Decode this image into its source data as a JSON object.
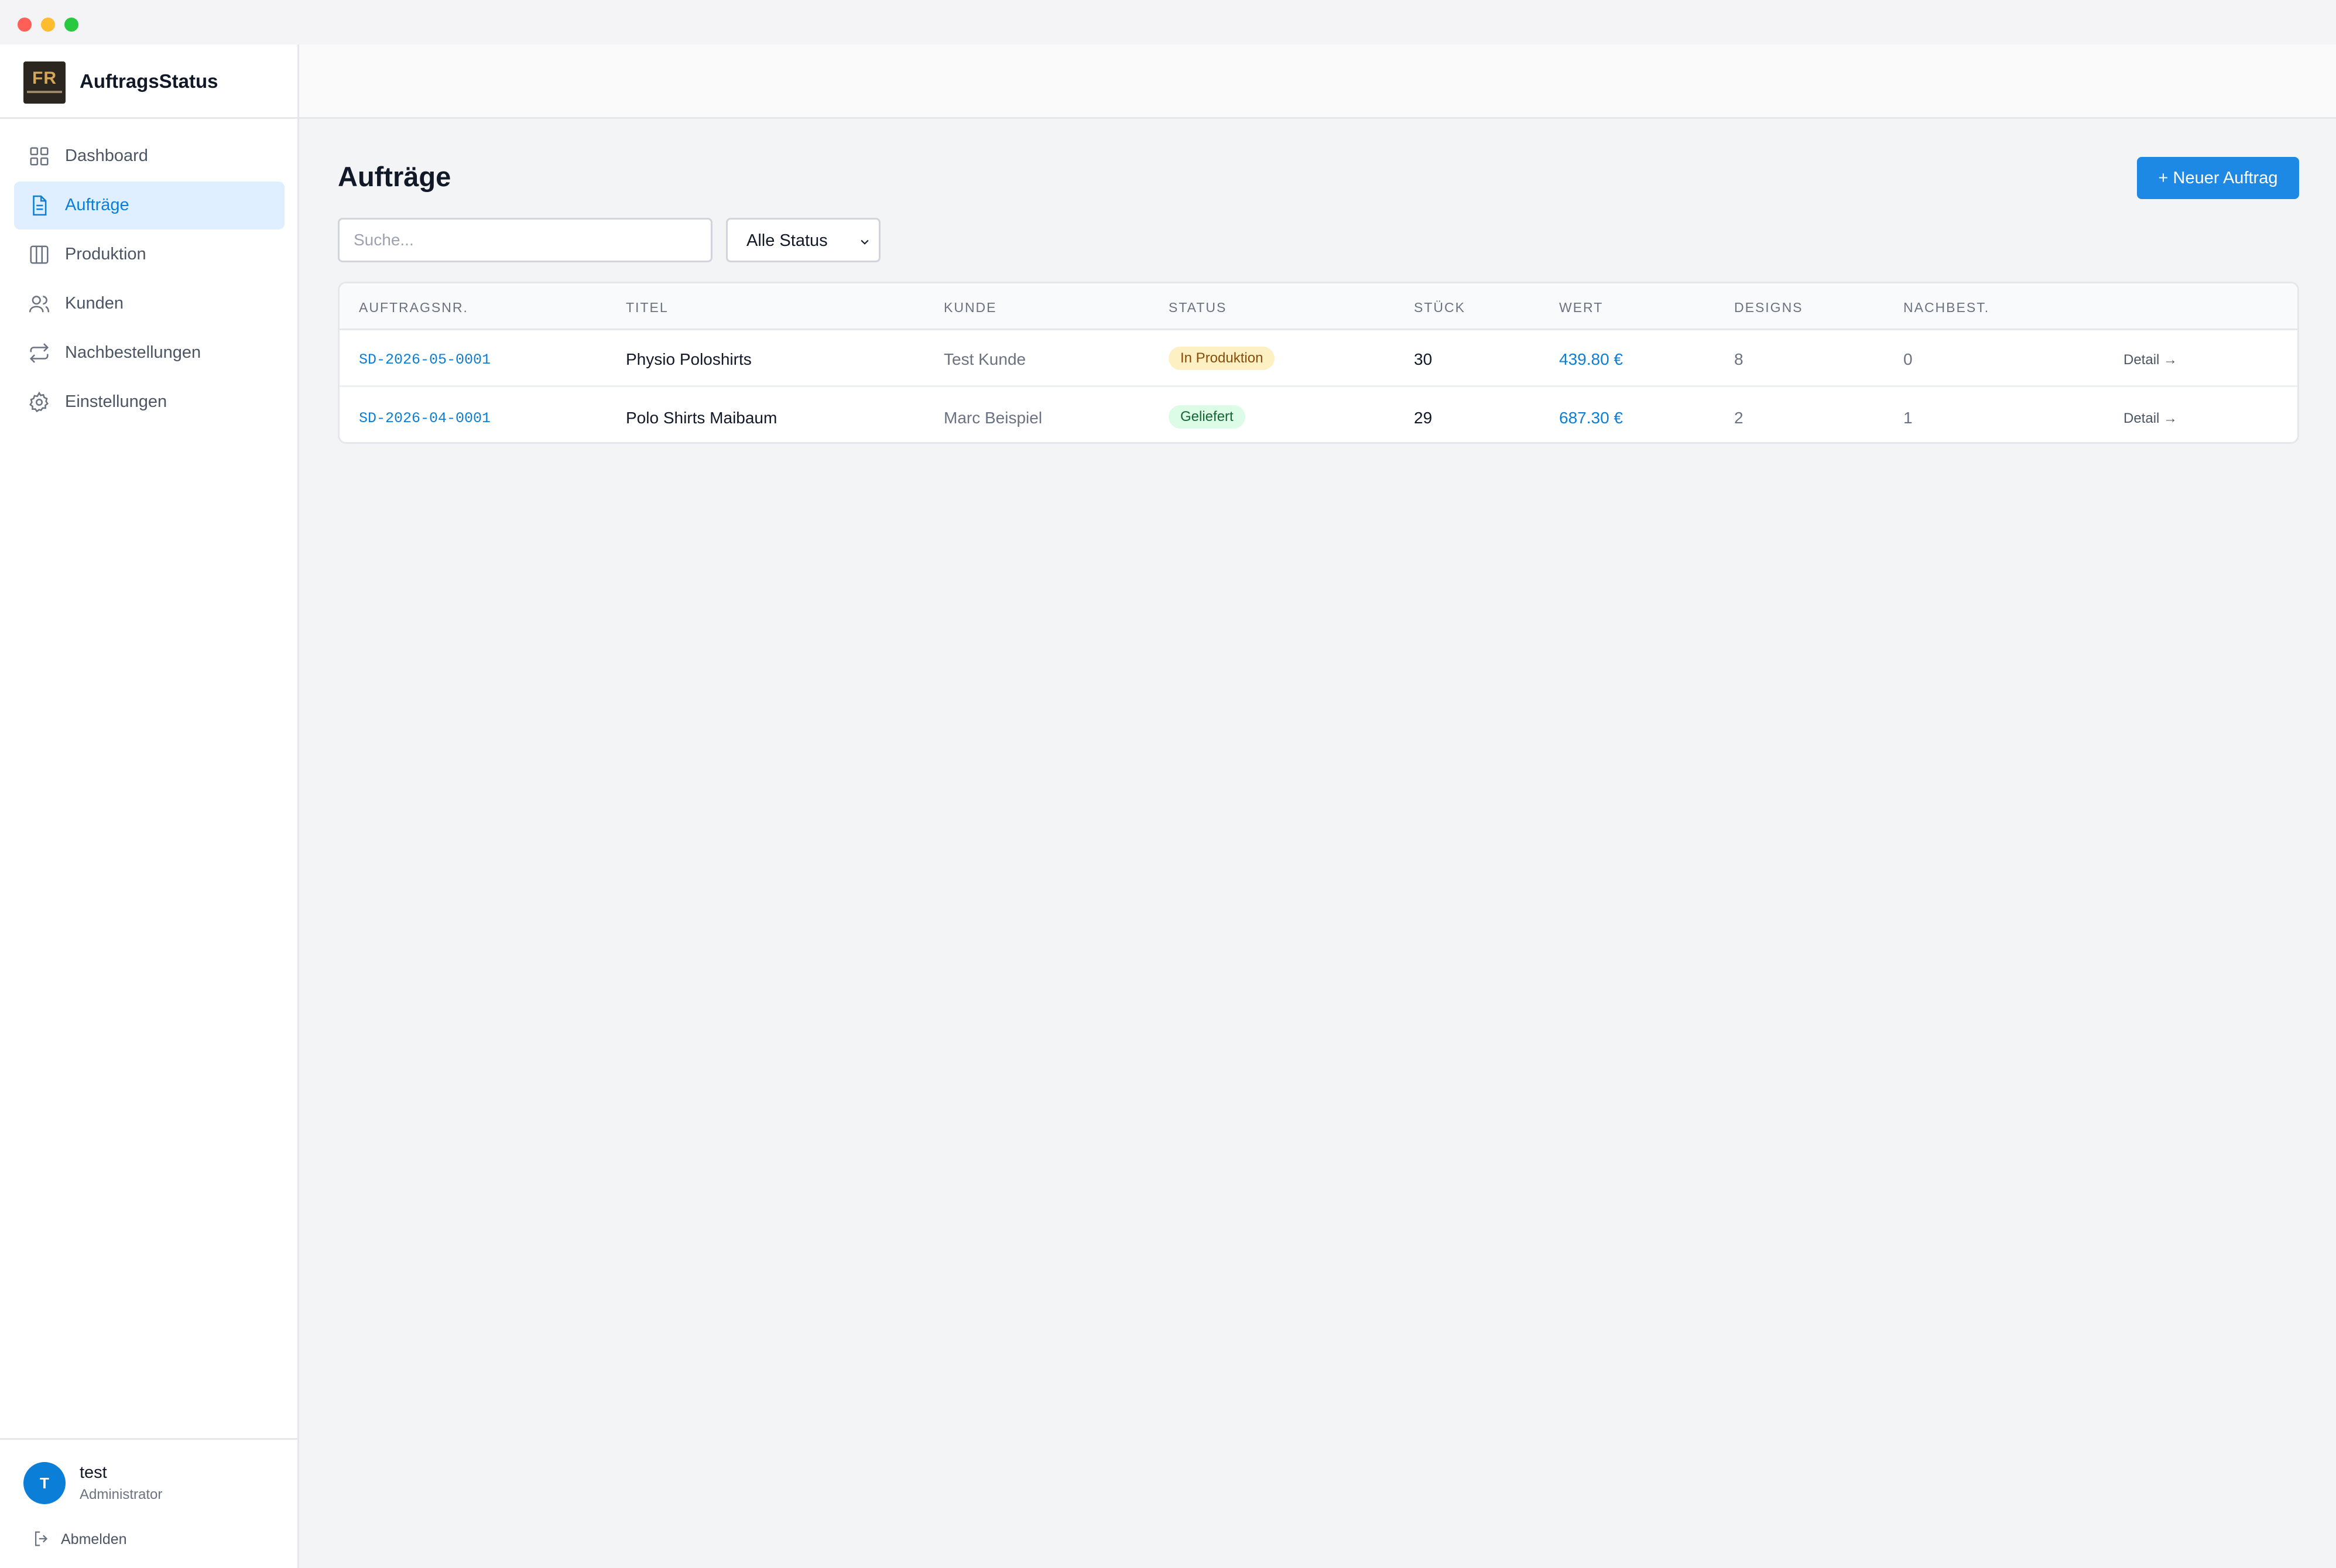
{
  "app": {
    "title": "AuftragsStatus",
    "logo_text": "FR"
  },
  "sidebar": {
    "items": [
      {
        "label": "Dashboard",
        "icon": "dashboard-grid-icon",
        "active": false
      },
      {
        "label": "Aufträge",
        "icon": "document-icon",
        "active": true
      },
      {
        "label": "Produktion",
        "icon": "columns-icon",
        "active": false
      },
      {
        "label": "Kunden",
        "icon": "users-icon",
        "active": false
      },
      {
        "label": "Nachbestellungen",
        "icon": "repeat-icon",
        "active": false
      },
      {
        "label": "Einstellungen",
        "icon": "gear-icon",
        "active": false
      }
    ],
    "user": {
      "initial": "T",
      "name": "test",
      "role": "Administrator"
    },
    "logout_label": "Abmelden"
  },
  "main": {
    "title": "Aufträge",
    "new_button": "+ Neuer Auftrag",
    "search_placeholder": "Suche...",
    "status_filter": "Alle Status",
    "table": {
      "headers": [
        "AUFTRAGSNR.",
        "TITEL",
        "KUNDE",
        "STATUS",
        "STÜCK",
        "WERT",
        "DESIGNS",
        "NACHBEST."
      ],
      "rows": [
        {
          "nr": "SD-2026-05-0001",
          "titel": "Physio Poloshirts",
          "kunde": "Test Kunde",
          "status": "In Produktion",
          "stueck": "30",
          "wert": "439.80 €",
          "designs": "8",
          "nachbest": "0",
          "detail": "Detail →"
        },
        {
          "nr": "SD-2026-04-0001",
          "titel": "Polo Shirts Maibaum",
          "kunde": "Marc Beispiel",
          "status": "Geliefert",
          "stueck": "29",
          "wert": "687.30 €",
          "designs": "2",
          "nachbest": "1",
          "detail": "Detail →"
        }
      ]
    }
  },
  "colors": {
    "accent": "#0b7ed8",
    "button": "#1e88e5",
    "status_in_produktion_bg": "#fdf1c4",
    "status_geliefert_bg": "#dcfce7"
  }
}
